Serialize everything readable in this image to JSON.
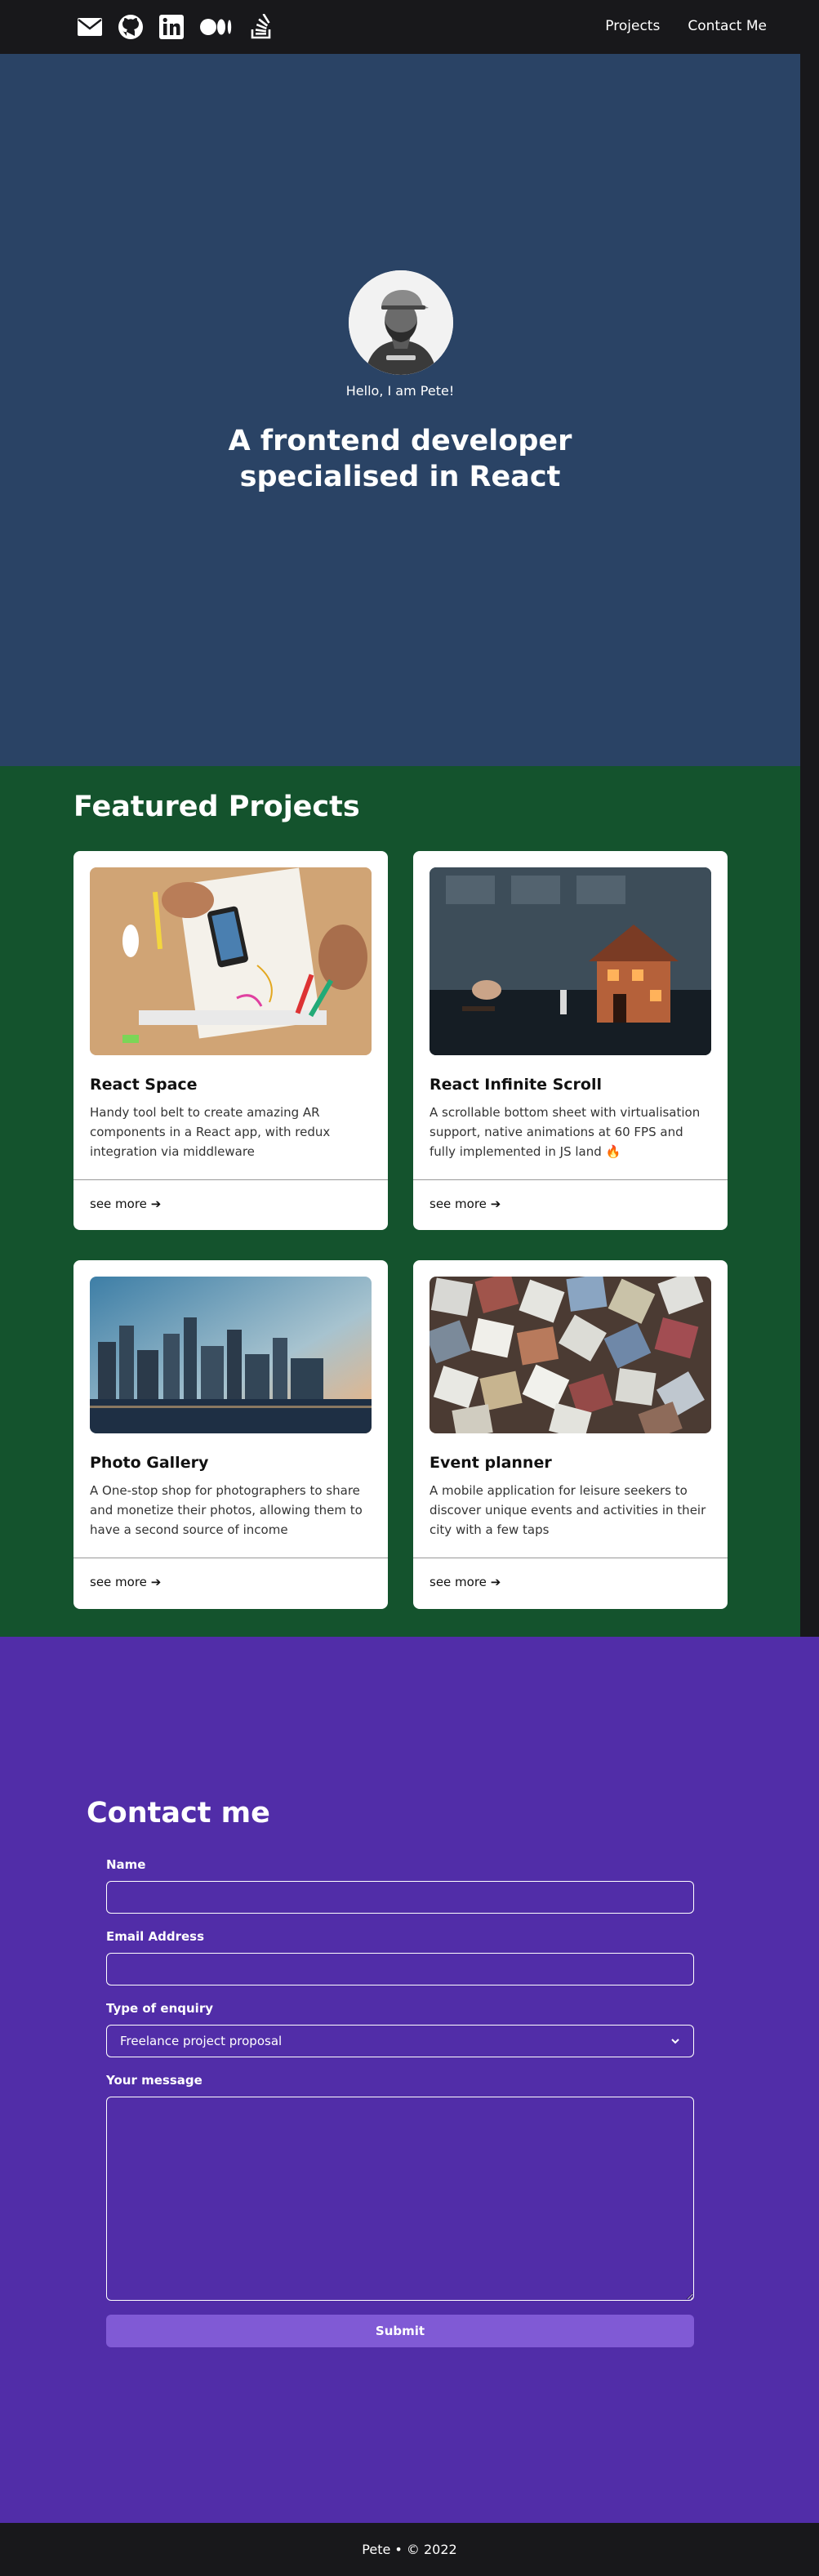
{
  "header": {
    "social_icons": [
      "envelope-icon",
      "github-icon",
      "linkedin-icon",
      "medium-icon",
      "stackoverflow-icon"
    ],
    "nav": {
      "projects": "Projects",
      "contact": "Contact Me"
    }
  },
  "hero": {
    "greeting": "Hello, I am Pete!",
    "headline_line1": "A frontend developer",
    "headline_line2": "specialised in React",
    "bg_color": "#2a4365"
  },
  "projects": {
    "title": "Featured Projects",
    "bg_color": "#14532d",
    "items": [
      {
        "title": "React Space",
        "description": "Handy tool belt to create amazing AR components in a React app, with redux integration via middleware",
        "link": "see more"
      },
      {
        "title": "React Infinite Scroll",
        "description": "A scrollable bottom sheet with virtualisation support, native animations at 60 FPS and fully implemented in JS land 🔥",
        "link": "see more"
      },
      {
        "title": "Photo Gallery",
        "description": "A One-stop shop for photographers to share and monetize their photos, allowing them to have a second source of income",
        "link": "see more"
      },
      {
        "title": "Event planner",
        "description": "A mobile application for leisure seekers to discover unique events and activities in their city with a few taps",
        "link": "see more"
      }
    ]
  },
  "contact": {
    "title": "Contact me",
    "bg_color": "#512da8",
    "name_label": "Name",
    "name_value": "",
    "email_label": "Email Address",
    "email_value": "",
    "enquiry_label": "Type of enquiry",
    "enquiry_selected": "Freelance project proposal",
    "message_label": "Your message",
    "message_value": "",
    "submit_label": "Submit",
    "button_color": "#805ad5"
  },
  "footer": {
    "text": "Pete • © 2022"
  }
}
